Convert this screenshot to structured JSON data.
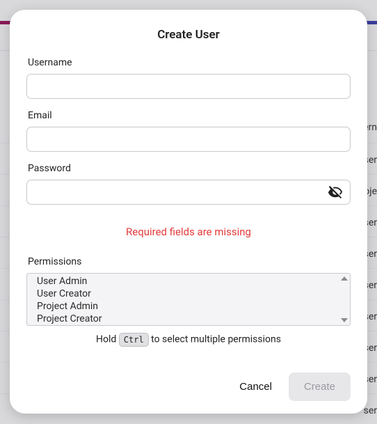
{
  "modal": {
    "title": "Create User",
    "fields": {
      "username": {
        "label": "Username",
        "value": ""
      },
      "email": {
        "label": "Email",
        "value": ""
      },
      "password": {
        "label": "Password",
        "value": ""
      }
    },
    "error": "Required fields are missing",
    "permissions": {
      "label": "Permissions",
      "options": [
        "User Admin",
        "User Creator",
        "Project Admin",
        "Project Creator"
      ]
    },
    "hint": {
      "pre": "Hold ",
      "key": "Ctrl",
      "post": " to select multiple permissions"
    },
    "buttons": {
      "cancel": "Cancel",
      "create": "Create"
    }
  },
  "background": {
    "col_header_partial": "ern",
    "row_partial": "ser",
    "row_proj_partial": "oje"
  }
}
